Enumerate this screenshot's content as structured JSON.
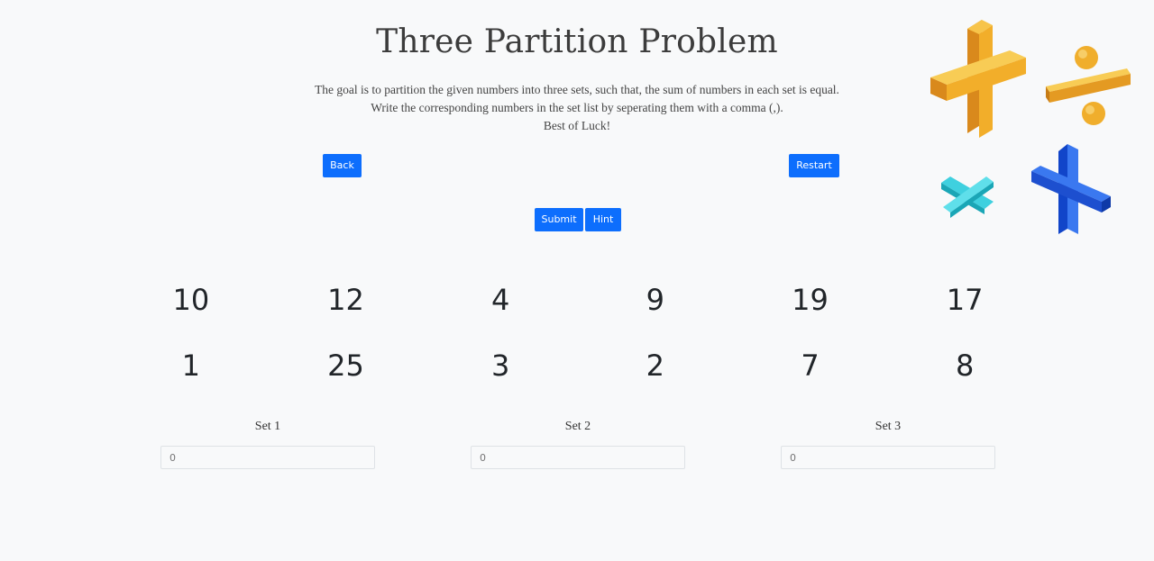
{
  "header": {
    "title": "Three Partition Problem",
    "description": [
      "The goal is to partition the given numbers into three sets, such that, the sum of numbers in each set is equal.",
      "Write the corresponding numbers in the set list by seperating them with a comma (,).",
      "Best of Luck!"
    ]
  },
  "buttons": {
    "back": "Back",
    "restart": "Restart",
    "submit": "Submit",
    "hint": "Hint"
  },
  "numbers": [
    "10",
    "12",
    "4",
    "9",
    "19",
    "17",
    "1",
    "25",
    "3",
    "2",
    "7",
    "8"
  ],
  "sets": [
    {
      "label": "Set 1",
      "placeholder": "0"
    },
    {
      "label": "Set 2",
      "placeholder": "0"
    },
    {
      "label": "Set 3",
      "placeholder": "0"
    }
  ],
  "decoration": {
    "icons": [
      "plus-icon",
      "divide-icon",
      "multiply-icon",
      "plus-icon"
    ]
  },
  "colors": {
    "primary": "#0d6efd",
    "background": "#f8f9fa"
  }
}
